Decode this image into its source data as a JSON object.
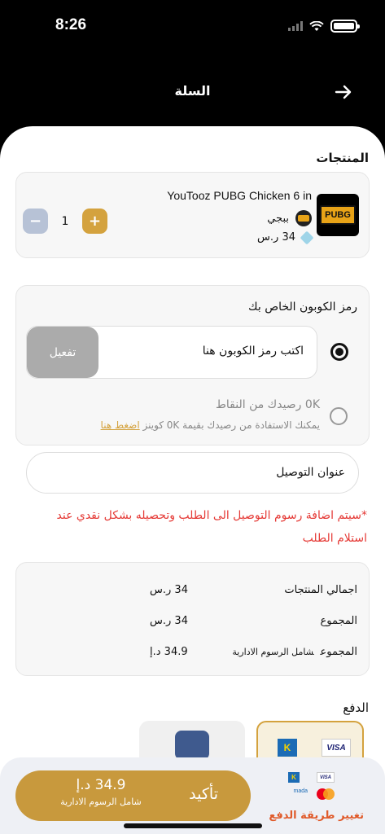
{
  "status_bar": {
    "time": "8:26"
  },
  "header": {
    "title": "السلة"
  },
  "products": {
    "title": "المنتجات",
    "item": {
      "image_text": "PUBG",
      "name": "YouTooz PUBG Chicken 6 in",
      "brand": "ببجي",
      "price": "34 ر.س",
      "quantity": "1",
      "minus": "−",
      "plus": "+"
    }
  },
  "coupon": {
    "label": "رمز الكوبون الخاص بك",
    "input_placeholder": "اكتب رمز الكوبون هنا",
    "activate_label": "تفعيل",
    "points_title": "0K رصيدك من النقاط",
    "points_desc": "يمكنك الاستفادة من رصيدك بقيمة  0K كوينز ",
    "points_link": "اضغط هنا"
  },
  "address": {
    "label": "عنوان التوصيل"
  },
  "delivery_note": "*سيتم اضافة رسوم التوصيل الى الطلب وتحصيله بشكل نقدي عند استلام الطلب",
  "summary": {
    "rows": [
      {
        "label": "اجمالي المنتجات",
        "sub": "",
        "value": "34 ر.س"
      },
      {
        "label": "المجموع",
        "sub": "",
        "value": "34 ر.س"
      },
      {
        "label": "المجموع",
        "sub": "شامل الرسوم الادارية",
        "value": "34.9 د.إ"
      }
    ]
  },
  "payment": {
    "title": "الدفع",
    "visa": "VISA",
    "knet": "K",
    "mada": "mada"
  },
  "bottom": {
    "confirm_label": "تأكيد",
    "amount": "34.9 د.إ",
    "amount_sub": "شامل الرسوم الادارية",
    "change_payment": "تغيير طريقة الدفع"
  },
  "colors": {
    "accent": "#c8993d",
    "plus_button": "#d4a23e",
    "minus_button": "#b7c2d6",
    "warning": "#e53935",
    "change_payment": "#e05a2a"
  }
}
